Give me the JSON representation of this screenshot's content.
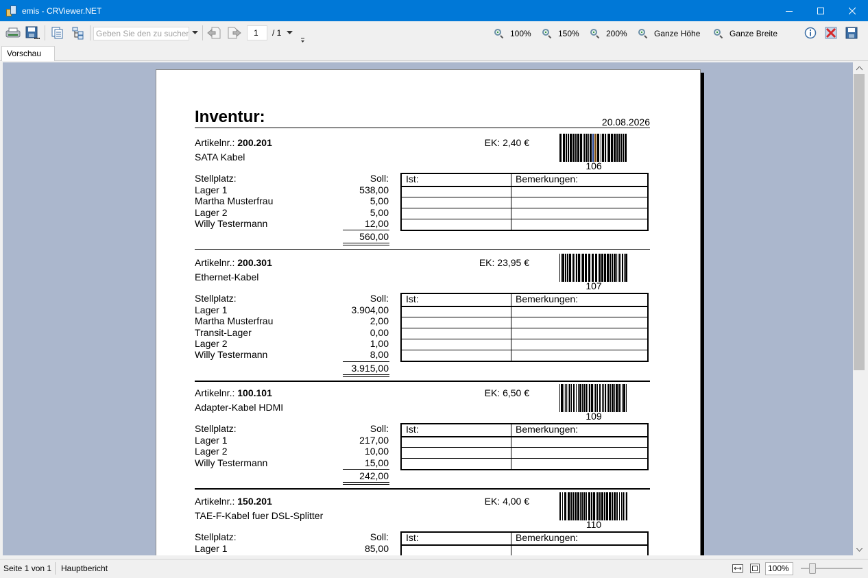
{
  "window": {
    "title": "emis - CRViewer.NET"
  },
  "toolbar": {
    "search_placeholder": "Geben Sie den zu suchen",
    "page_current": "1",
    "page_total": "/ 1",
    "zoom": [
      "100%",
      "150%",
      "200%",
      "Ganze Höhe",
      "Ganze Breite"
    ]
  },
  "tabs": [
    {
      "label": "Vorschau"
    }
  ],
  "report": {
    "title": "Inventur:",
    "date": "20.08.2026",
    "labels": {
      "artikelnr": "Artikelnr.:",
      "stellplatz": "Stellplatz:",
      "soll": "Soll:",
      "ist": "Ist:",
      "bemerkungen": "Bemerkungen:"
    },
    "articles": [
      {
        "artnr": "200.201",
        "name": "SATA Kabel",
        "ek": "EK: 2,40 €",
        "barcode": "106",
        "locations": [
          {
            "place": "Lager 1",
            "soll": "538,00"
          },
          {
            "place": "Martha Musterfrau",
            "soll": "5,00"
          },
          {
            "place": "Lager 2",
            "soll": "5,00"
          },
          {
            "place": "Willy Testermann",
            "soll": "12,00"
          }
        ],
        "total": "560,00"
      },
      {
        "artnr": "200.301",
        "name": "Ethernet-Kabel",
        "ek": "EK: 23,95 €",
        "barcode": "107",
        "locations": [
          {
            "place": "Lager 1",
            "soll": "3.904,00"
          },
          {
            "place": "Martha Musterfrau",
            "soll": "2,00"
          },
          {
            "place": "Transit-Lager",
            "soll": "0,00"
          },
          {
            "place": "Lager 2",
            "soll": "1,00"
          },
          {
            "place": "Willy Testermann",
            "soll": "8,00"
          }
        ],
        "total": "3.915,00"
      },
      {
        "artnr": "100.101",
        "name": "Adapter-Kabel HDMI",
        "ek": "EK: 6,50 €",
        "barcode": "109",
        "locations": [
          {
            "place": "Lager 1",
            "soll": "217,00"
          },
          {
            "place": "Lager 2",
            "soll": "10,00"
          },
          {
            "place": "Willy Testermann",
            "soll": "15,00"
          }
        ],
        "total": "242,00"
      },
      {
        "artnr": "150.201",
        "name": "TAE-F-Kabel fuer DSL-Splitter",
        "ek": "EK: 4,00 €",
        "barcode": "110",
        "locations": [
          {
            "place": "Lager 1",
            "soll": "85,00"
          }
        ],
        "total": ""
      }
    ]
  },
  "statusbar": {
    "page_info": "Seite 1 von 1",
    "report_name": "Hauptbericht",
    "zoom": "100%"
  }
}
